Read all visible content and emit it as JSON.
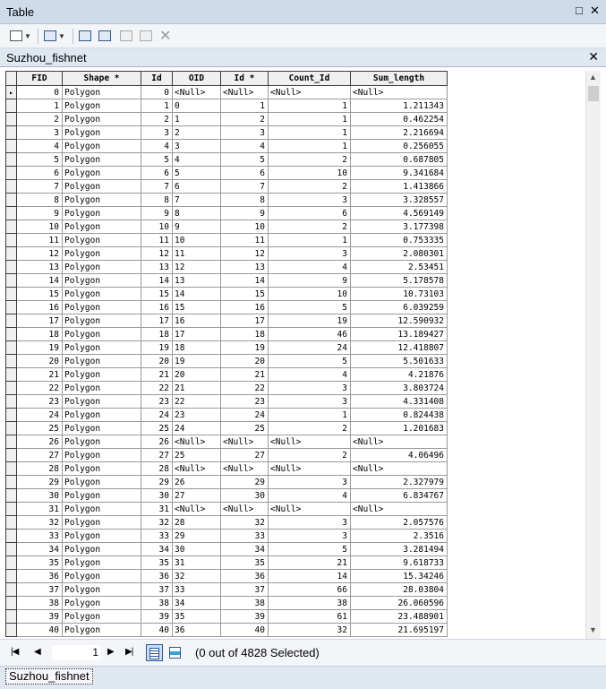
{
  "window": {
    "title": "Table"
  },
  "toolbar": {
    "table_options_icon": "table-options-icon",
    "related_tables_icon": "related-tables-icon",
    "select_by_attributes_icon": "select-by-attributes-icon",
    "switch_selection_icon": "switch-selection-icon",
    "clear_selection_icon": "clear-selection-icon",
    "zoom_to_selected_icon": "zoom-to-selected-icon",
    "delete_selected_icon": "delete-selected-icon"
  },
  "tab": {
    "name": "Suzhou_fishnet"
  },
  "table": {
    "columns": [
      "FID",
      "Shape *",
      "Id",
      "OID",
      "Id *",
      "Count_Id",
      "Sum_length"
    ],
    "rows": [
      [
        "0",
        "Polygon",
        "0",
        "<Null>",
        "<Null>",
        "<Null>",
        "<Null>"
      ],
      [
        "1",
        "Polygon",
        "1",
        "0",
        "1",
        "1",
        "1.211343"
      ],
      [
        "2",
        "Polygon",
        "2",
        "1",
        "2",
        "1",
        "0.462254"
      ],
      [
        "3",
        "Polygon",
        "3",
        "2",
        "3",
        "1",
        "2.216694"
      ],
      [
        "4",
        "Polygon",
        "4",
        "3",
        "4",
        "1",
        "0.256055"
      ],
      [
        "5",
        "Polygon",
        "5",
        "4",
        "5",
        "2",
        "0.687805"
      ],
      [
        "6",
        "Polygon",
        "6",
        "5",
        "6",
        "10",
        "9.341684"
      ],
      [
        "7",
        "Polygon",
        "7",
        "6",
        "7",
        "2",
        "1.413866"
      ],
      [
        "8",
        "Polygon",
        "8",
        "7",
        "8",
        "3",
        "3.328557"
      ],
      [
        "9",
        "Polygon",
        "9",
        "8",
        "9",
        "6",
        "4.569149"
      ],
      [
        "10",
        "Polygon",
        "10",
        "9",
        "10",
        "2",
        "3.177398"
      ],
      [
        "11",
        "Polygon",
        "11",
        "10",
        "11",
        "1",
        "0.753335"
      ],
      [
        "12",
        "Polygon",
        "12",
        "11",
        "12",
        "3",
        "2.080301"
      ],
      [
        "13",
        "Polygon",
        "13",
        "12",
        "13",
        "4",
        "2.53451"
      ],
      [
        "14",
        "Polygon",
        "14",
        "13",
        "14",
        "9",
        "5.178578"
      ],
      [
        "15",
        "Polygon",
        "15",
        "14",
        "15",
        "10",
        "10.73103"
      ],
      [
        "16",
        "Polygon",
        "16",
        "15",
        "16",
        "5",
        "6.039259"
      ],
      [
        "17",
        "Polygon",
        "17",
        "16",
        "17",
        "19",
        "12.590932"
      ],
      [
        "18",
        "Polygon",
        "18",
        "17",
        "18",
        "46",
        "13.189427"
      ],
      [
        "19",
        "Polygon",
        "19",
        "18",
        "19",
        "24",
        "12.418807"
      ],
      [
        "20",
        "Polygon",
        "20",
        "19",
        "20",
        "5",
        "5.501633"
      ],
      [
        "21",
        "Polygon",
        "21",
        "20",
        "21",
        "4",
        "4.21876"
      ],
      [
        "22",
        "Polygon",
        "22",
        "21",
        "22",
        "3",
        "3.803724"
      ],
      [
        "23",
        "Polygon",
        "23",
        "22",
        "23",
        "3",
        "4.331408"
      ],
      [
        "24",
        "Polygon",
        "24",
        "23",
        "24",
        "1",
        "0.824438"
      ],
      [
        "25",
        "Polygon",
        "25",
        "24",
        "25",
        "2",
        "1.201683"
      ],
      [
        "26",
        "Polygon",
        "26",
        "<Null>",
        "<Null>",
        "<Null>",
        "<Null>"
      ],
      [
        "27",
        "Polygon",
        "27",
        "25",
        "27",
        "2",
        "4.06496"
      ],
      [
        "28",
        "Polygon",
        "28",
        "<Null>",
        "<Null>",
        "<Null>",
        "<Null>"
      ],
      [
        "29",
        "Polygon",
        "29",
        "26",
        "29",
        "3",
        "2.327979"
      ],
      [
        "30",
        "Polygon",
        "30",
        "27",
        "30",
        "4",
        "6.834767"
      ],
      [
        "31",
        "Polygon",
        "31",
        "<Null>",
        "<Null>",
        "<Null>",
        "<Null>"
      ],
      [
        "32",
        "Polygon",
        "32",
        "28",
        "32",
        "3",
        "2.057576"
      ],
      [
        "33",
        "Polygon",
        "33",
        "29",
        "33",
        "3",
        "2.3516"
      ],
      [
        "34",
        "Polygon",
        "34",
        "30",
        "34",
        "5",
        "3.281494"
      ],
      [
        "35",
        "Polygon",
        "35",
        "31",
        "35",
        "21",
        "9.618733"
      ],
      [
        "36",
        "Polygon",
        "36",
        "32",
        "36",
        "14",
        "15.34246"
      ],
      [
        "37",
        "Polygon",
        "37",
        "33",
        "37",
        "66",
        "28.03804"
      ],
      [
        "38",
        "Polygon",
        "38",
        "34",
        "38",
        "38",
        "26.060596"
      ],
      [
        "39",
        "Polygon",
        "39",
        "35",
        "39",
        "61",
        "23.488901"
      ],
      [
        "40",
        "Polygon",
        "40",
        "36",
        "40",
        "32",
        "21.695197"
      ]
    ],
    "current_row_marker": "▸"
  },
  "navigation": {
    "current_record": "1",
    "status": "(0 out of 4828 Selected)"
  },
  "bottom_tab": {
    "name": "Suzhou_fishnet"
  },
  "colors": {
    "title_bar": "#cfdbea",
    "toolbar": "#f3f5f8",
    "header_bg": "#f0f0f0",
    "icon_blue": "#2e5a93"
  }
}
